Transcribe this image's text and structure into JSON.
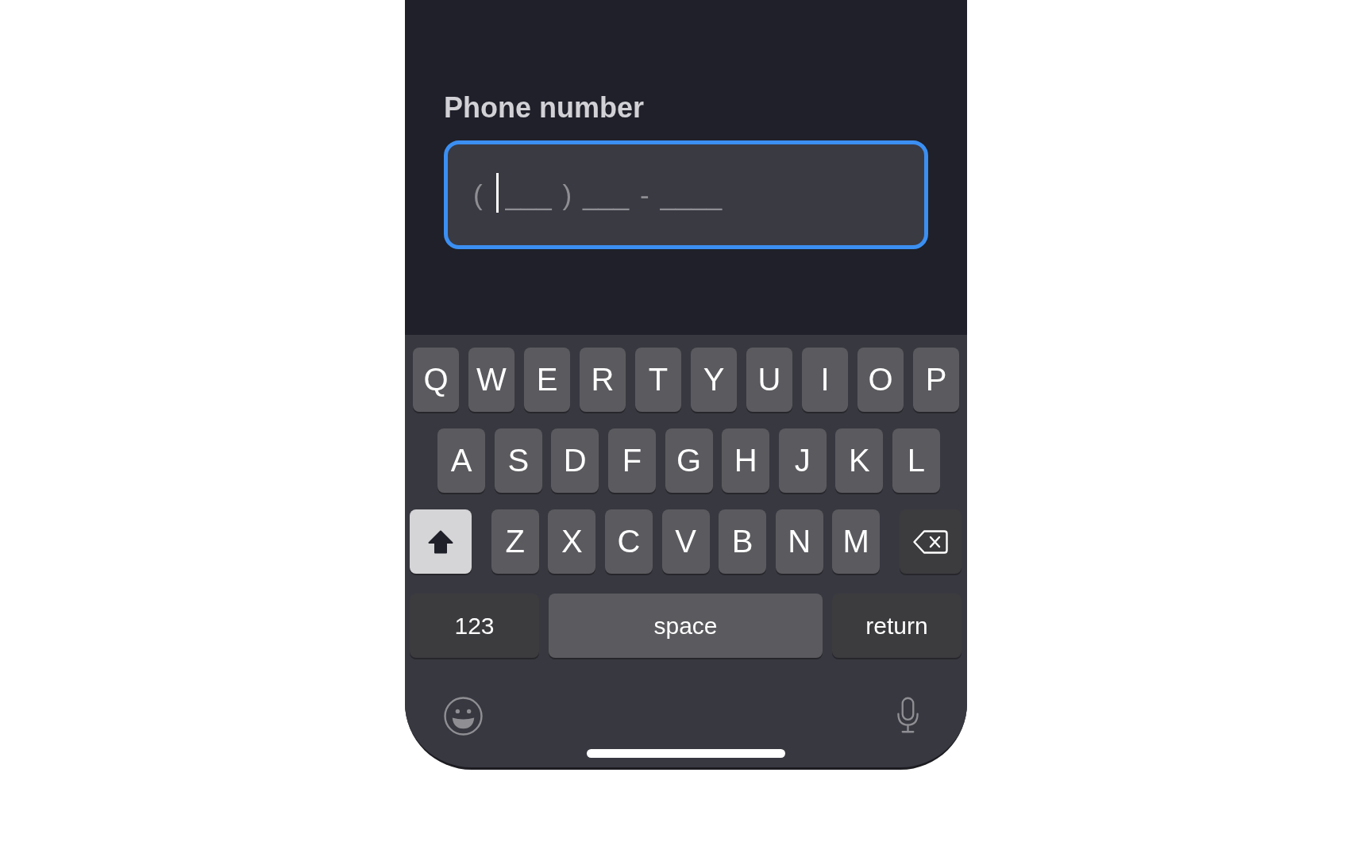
{
  "screen": {
    "field": {
      "label": "Phone number",
      "placeholder": "( ___ ) ___ - ____",
      "focused": true
    }
  },
  "keyboard": {
    "rows": [
      {
        "keys": [
          {
            "kind": "letter",
            "label": "Q"
          },
          {
            "kind": "letter",
            "label": "W"
          },
          {
            "kind": "letter",
            "label": "E"
          },
          {
            "kind": "letter",
            "label": "R"
          },
          {
            "kind": "letter",
            "label": "T"
          },
          {
            "kind": "letter",
            "label": "Y"
          },
          {
            "kind": "letter",
            "label": "U"
          },
          {
            "kind": "letter",
            "label": "I"
          },
          {
            "kind": "letter",
            "label": "O"
          },
          {
            "kind": "letter",
            "label": "P"
          }
        ]
      },
      {
        "keys": [
          {
            "kind": "letter",
            "label": "A"
          },
          {
            "kind": "letter",
            "label": "S"
          },
          {
            "kind": "letter",
            "label": "D"
          },
          {
            "kind": "letter",
            "label": "F"
          },
          {
            "kind": "letter",
            "label": "G"
          },
          {
            "kind": "letter",
            "label": "H"
          },
          {
            "kind": "letter",
            "label": "J"
          },
          {
            "kind": "letter",
            "label": "K"
          },
          {
            "kind": "letter",
            "label": "L"
          }
        ]
      },
      {
        "keys": [
          {
            "kind": "shift",
            "on": true
          },
          {
            "kind": "letter",
            "label": "Z"
          },
          {
            "kind": "letter",
            "label": "X"
          },
          {
            "kind": "letter",
            "label": "C"
          },
          {
            "kind": "letter",
            "label": "V"
          },
          {
            "kind": "letter",
            "label": "B"
          },
          {
            "kind": "letter",
            "label": "N"
          },
          {
            "kind": "letter",
            "label": "M"
          },
          {
            "kind": "delete"
          }
        ]
      },
      {
        "keys": [
          {
            "kind": "mode",
            "label": "123"
          },
          {
            "kind": "space",
            "label": "space"
          },
          {
            "kind": "return",
            "label": "return"
          }
        ]
      }
    ]
  }
}
